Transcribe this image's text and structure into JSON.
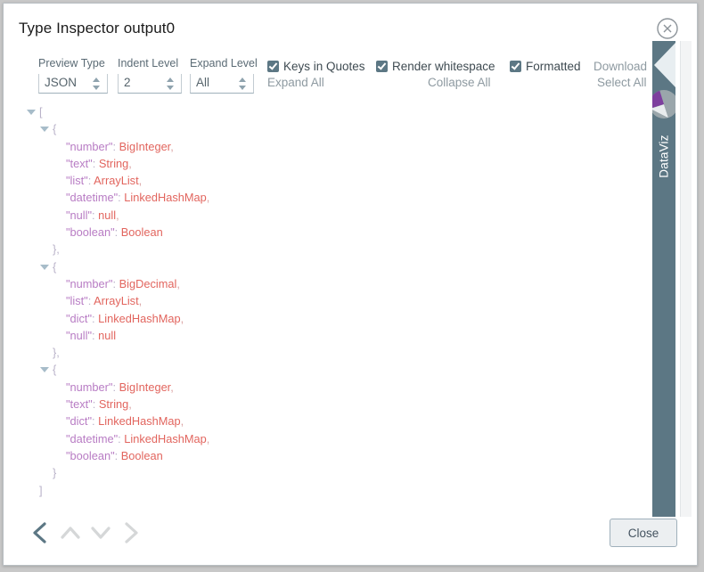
{
  "dialog": {
    "title": "Type Inspector output0",
    "close_icon": "close-circle-icon"
  },
  "toolbar": {
    "fields": [
      {
        "label": "Preview Type",
        "value": "JSON"
      },
      {
        "label": "Indent Level",
        "value": "2"
      },
      {
        "label": "Expand Level",
        "value": "All"
      }
    ],
    "checkboxes": [
      {
        "label": "Keys in Quotes",
        "checked": true
      },
      {
        "label": "Render whitespace",
        "checked": true
      },
      {
        "label": "Formatted",
        "checked": true
      }
    ],
    "download_label": "Download",
    "expand_all_label": "Expand All",
    "collapse_all_label": "Collapse All",
    "select_all_label": "Select All"
  },
  "tree": {
    "lines": [
      {
        "indent": 0,
        "marker": true,
        "punct": "["
      },
      {
        "indent": 1,
        "marker": true,
        "punct": "{"
      },
      {
        "indent": 2,
        "key": "\"number\"",
        "value": "BigInteger",
        "comma": ","
      },
      {
        "indent": 2,
        "key": "\"text\"",
        "value": "String",
        "comma": ","
      },
      {
        "indent": 2,
        "key": "\"list\"",
        "value": "ArrayList",
        "comma": ","
      },
      {
        "indent": 2,
        "key": "\"datetime\"",
        "value": "LinkedHashMap",
        "comma": ","
      },
      {
        "indent": 2,
        "key": "\"null\"",
        "value": "null",
        "comma": ","
      },
      {
        "indent": 2,
        "key": "\"boolean\"",
        "value": "Boolean",
        "comma": ""
      },
      {
        "indent": 1,
        "marker": false,
        "punct": "},"
      },
      {
        "indent": 1,
        "marker": true,
        "punct": "{"
      },
      {
        "indent": 2,
        "key": "\"number\"",
        "value": "BigDecimal",
        "comma": ","
      },
      {
        "indent": 2,
        "key": "\"list\"",
        "value": "ArrayList",
        "comma": ","
      },
      {
        "indent": 2,
        "key": "\"dict\"",
        "value": "LinkedHashMap",
        "comma": ","
      },
      {
        "indent": 2,
        "key": "\"null\"",
        "value": "null",
        "comma": ""
      },
      {
        "indent": 1,
        "marker": false,
        "punct": "},"
      },
      {
        "indent": 1,
        "marker": true,
        "punct": "{"
      },
      {
        "indent": 2,
        "key": "\"number\"",
        "value": "BigInteger",
        "comma": ","
      },
      {
        "indent": 2,
        "key": "\"text\"",
        "value": "String",
        "comma": ","
      },
      {
        "indent": 2,
        "key": "\"dict\"",
        "value": "LinkedHashMap",
        "comma": ","
      },
      {
        "indent": 2,
        "key": "\"datetime\"",
        "value": "LinkedHashMap",
        "comma": ","
      },
      {
        "indent": 2,
        "key": "\"boolean\"",
        "value": "Boolean",
        "comma": ""
      },
      {
        "indent": 1,
        "marker": false,
        "punct": "}"
      },
      {
        "indent": 0,
        "marker": false,
        "punct": "]"
      }
    ]
  },
  "side_tab": {
    "label": "DataViz",
    "chevron_icon": "chevron-left-icon",
    "pie_icon": "pie-chart-icon"
  },
  "footer": {
    "nav": [
      {
        "name": "prev-arrow",
        "icon": "chevron-left-icon",
        "active": true
      },
      {
        "name": "up-arrow",
        "icon": "chevron-up-icon",
        "active": false
      },
      {
        "name": "down-arrow",
        "icon": "chevron-down-icon",
        "active": false
      },
      {
        "name": "next-arrow",
        "icon": "chevron-right-icon",
        "active": false
      }
    ],
    "close_label": "Close"
  },
  "colors": {
    "accent": "#5c7784",
    "key": "#b87cc4",
    "value": "#e2655e",
    "punct": "#b9b2c9",
    "muted": "#8e9aa1"
  }
}
